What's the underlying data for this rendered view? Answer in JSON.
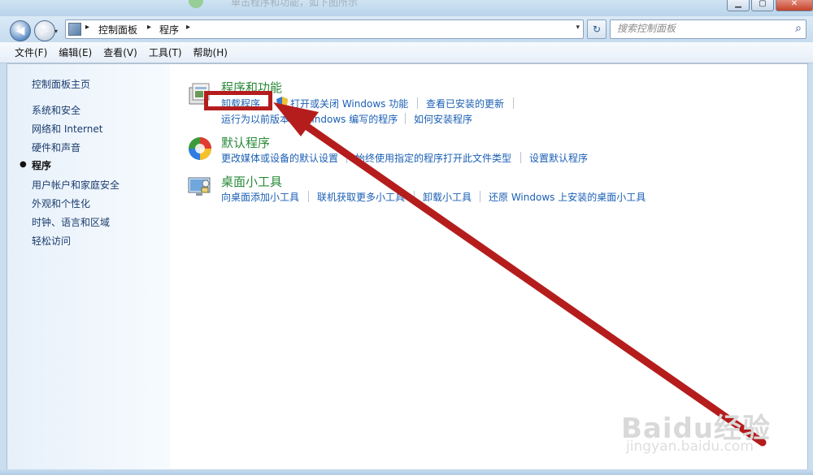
{
  "window": {
    "faded_title": "单击程序和功能，如下图所示",
    "controls": [
      "▁",
      "▢",
      "✕"
    ]
  },
  "nav": {
    "back_glyph": "◀",
    "forward_glyph": "▶",
    "dropdown_glyph": "▾"
  },
  "address": {
    "separator": "▸",
    "crumbs": [
      "控制面板",
      "程序"
    ],
    "dropdown_glyph": "▾",
    "refresh_glyph": "↻"
  },
  "search": {
    "placeholder": "搜索控制面板",
    "icon_glyph": "⌕"
  },
  "menu": {
    "items": [
      "文件(F)",
      "编辑(E)",
      "查看(V)",
      "工具(T)",
      "帮助(H)"
    ]
  },
  "sidebar": {
    "items": [
      {
        "label": "控制面板主页",
        "active": false
      },
      {
        "label": "系统和安全",
        "active": false
      },
      {
        "label": "网络和 Internet",
        "active": false
      },
      {
        "label": "硬件和声音",
        "active": false
      },
      {
        "label": "程序",
        "active": true
      },
      {
        "label": "用户帐户和家庭安全",
        "active": false
      },
      {
        "label": "外观和个性化",
        "active": false
      },
      {
        "label": "时钟、语言和区域",
        "active": false
      },
      {
        "label": "轻松访问",
        "active": false
      }
    ],
    "bullet": "●"
  },
  "categories": [
    {
      "title": "程序和功能",
      "icon": "programs-icon",
      "links": [
        "卸载程序",
        "打开或关闭 Windows 功能",
        "查看已安装的更新",
        "运行为以前版本的 Windows 编写的程序",
        "如何安装程序"
      ]
    },
    {
      "title": "默认程序",
      "icon": "default-programs-icon",
      "links": [
        "更改媒体或设备的默认设置",
        "始终使用指定的程序打开此文件类型",
        "设置默认程序"
      ]
    },
    {
      "title": "桌面小工具",
      "icon": "gadgets-icon",
      "links": [
        "向桌面添加小工具",
        "联机获取更多小工具",
        "卸载小工具",
        "还原 Windows 上安装的桌面小工具"
      ]
    }
  ],
  "watermark": {
    "logo": "Baidu经验",
    "url": "jingyan.baidu.com"
  },
  "colors": {
    "link": "#1b5fb4",
    "category_title": "#2a8a3a",
    "annotation": "#b51d1d"
  }
}
